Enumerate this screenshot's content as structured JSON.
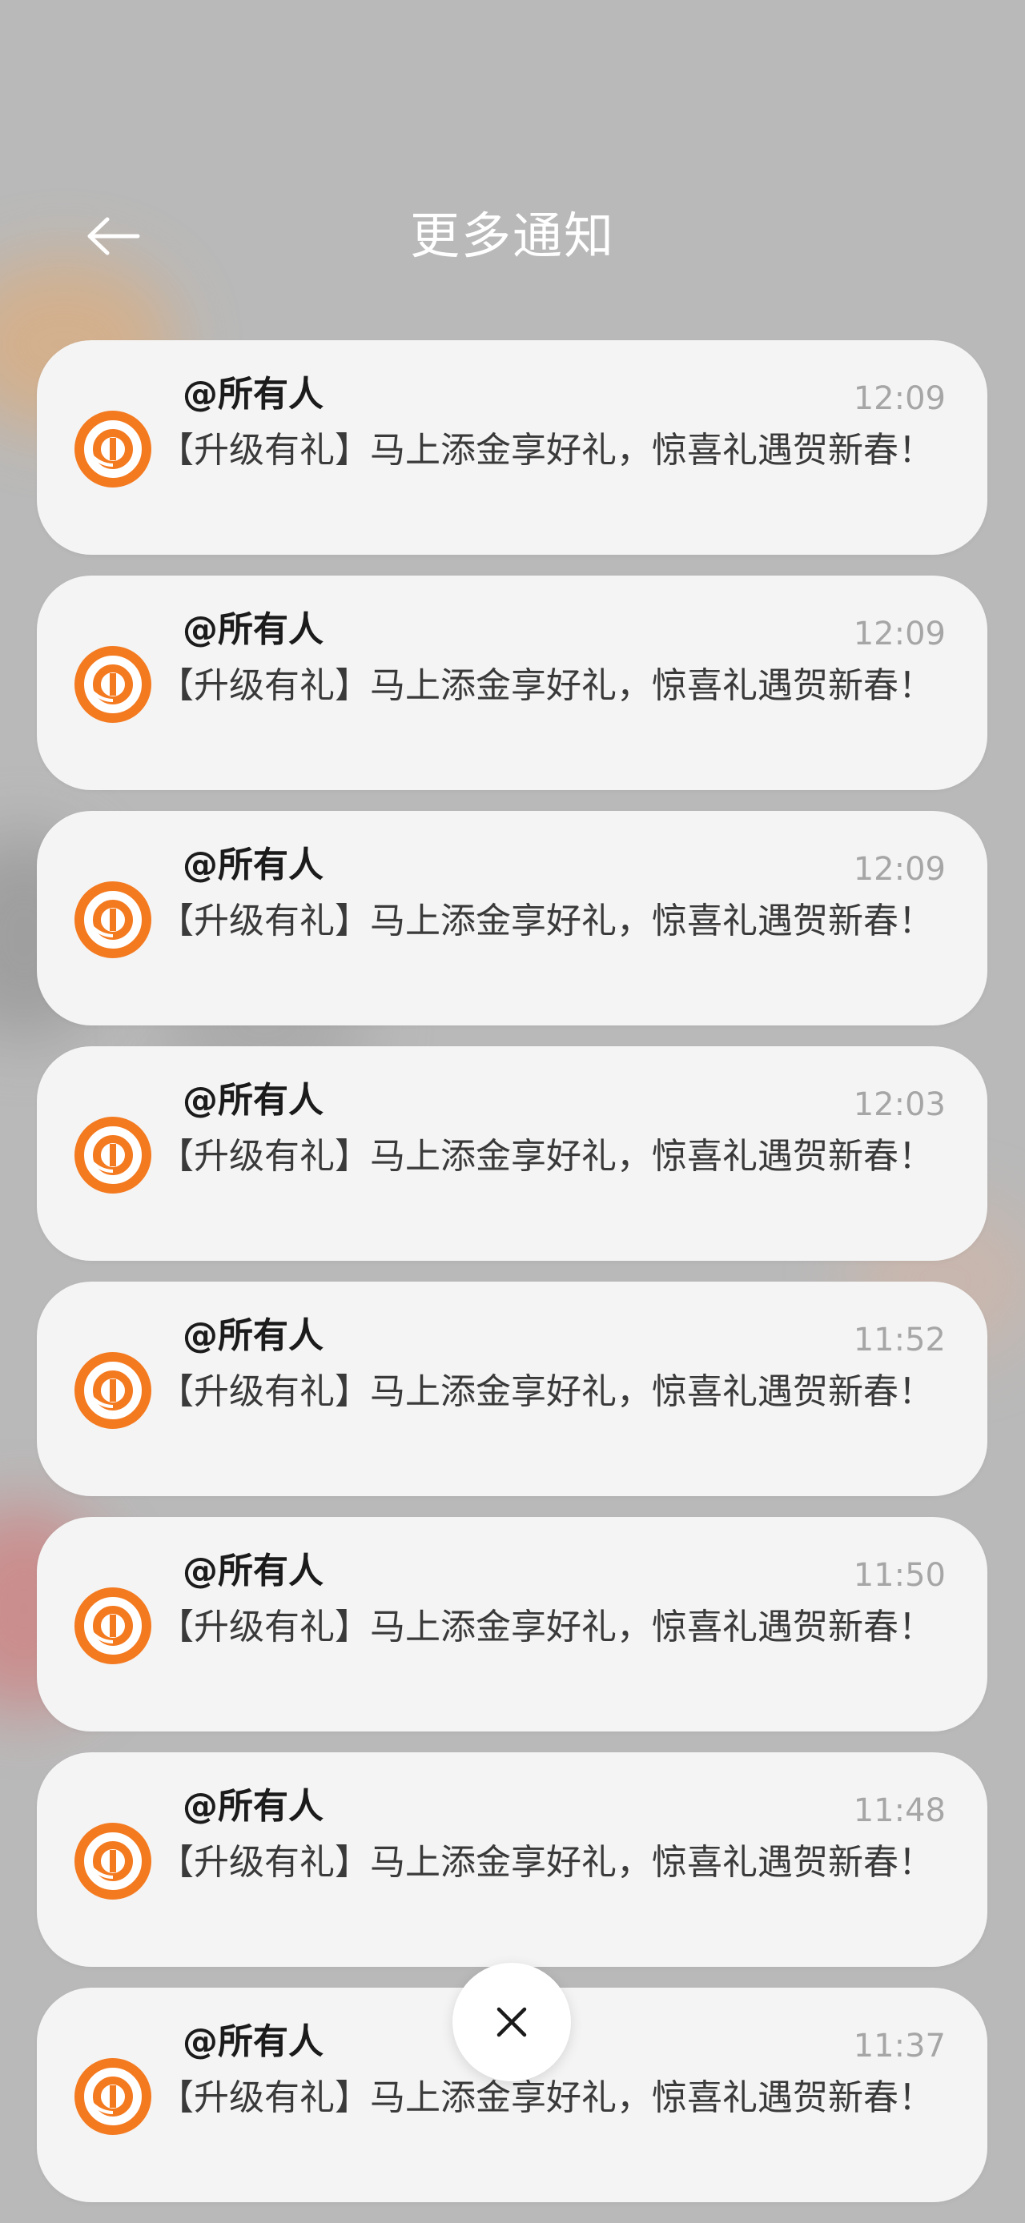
{
  "header": {
    "title": "更多通知"
  },
  "notifications": [
    {
      "sender": "@所有人",
      "time": "12:09",
      "message": "【升级有礼】马上添金享好礼，惊喜礼遇贺新春！"
    },
    {
      "sender": "@所有人",
      "time": "12:09",
      "message": "【升级有礼】马上添金享好礼，惊喜礼遇贺新春！"
    },
    {
      "sender": "@所有人",
      "time": "12:09",
      "message": "【升级有礼】马上添金享好礼，惊喜礼遇贺新春！"
    },
    {
      "sender": "@所有人",
      "time": "12:03",
      "message": "【升级有礼】马上添金享好礼，惊喜礼遇贺新春！"
    },
    {
      "sender": "@所有人",
      "time": "11:52",
      "message": "【升级有礼】马上添金享好礼，惊喜礼遇贺新春！"
    },
    {
      "sender": "@所有人",
      "time": "11:50",
      "message": "【升级有礼】马上添金享好礼，惊喜礼遇贺新春！"
    },
    {
      "sender": "@所有人",
      "time": "11:48",
      "message": "【升级有礼】马上添金享好礼，惊喜礼遇贺新春！"
    },
    {
      "sender": "@所有人",
      "time": "11:37",
      "message": "【升级有礼】马上添金享好礼，惊喜礼遇贺新春！"
    }
  ],
  "icons": {
    "back": "back-arrow-icon",
    "app": "app-logo-icon",
    "close": "close-icon"
  },
  "colors": {
    "accent_orange": "#f47a20",
    "card_bg": "#f4f4f4",
    "time_gray": "#a6a6a6"
  }
}
